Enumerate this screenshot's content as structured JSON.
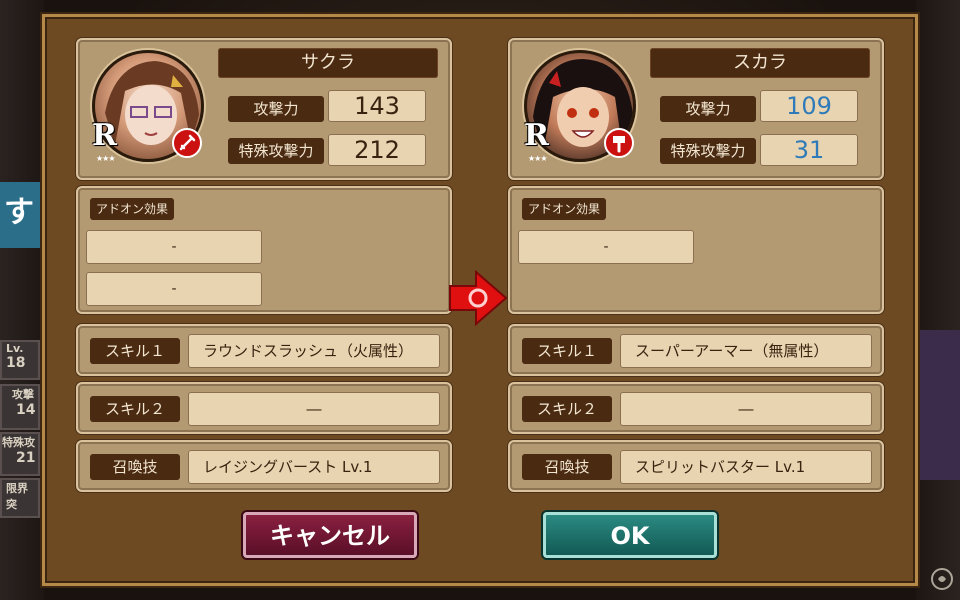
{
  "left": {
    "name": "サクラ",
    "rarity": "R",
    "stars": "★★★",
    "attack_label": "攻撃力",
    "attack_value": "143",
    "special_label": "特殊攻撃力",
    "special_value": "212",
    "addon_label": "アドオン効果",
    "addon_slots": [
      "-",
      "-"
    ],
    "skill1_label": "スキル１",
    "skill1_value": "ラウンドスラッシュ（火属性）",
    "skill2_label": "スキル２",
    "skill2_value": "―",
    "summon_label": "召喚技",
    "summon_value": "レイジングバースト Lv.1"
  },
  "right": {
    "name": "スカラ",
    "rarity": "R",
    "stars": "★★★",
    "attack_label": "攻撃力",
    "attack_value": "109",
    "special_label": "特殊攻撃力",
    "special_value": "31",
    "addon_label": "アドオン効果",
    "addon_slots": [
      "-"
    ],
    "skill1_label": "スキル１",
    "skill1_value": "スーパーアーマー（無属性）",
    "skill2_label": "スキル２",
    "skill2_value": "―",
    "summon_label": "召喚技",
    "summon_value": "スピリットバスター Lv.1"
  },
  "buttons": {
    "cancel": "キャンセル",
    "ok": "OK"
  },
  "background": {
    "blue_tab": "す",
    "lv_label": "Lv.",
    "lv_value": "18",
    "attack_short": "攻撃",
    "attack_value": "14",
    "special_short": "特殊攻",
    "special_value": "21",
    "limit_short": "限界突"
  },
  "colors": {
    "frame": "#6d4a22",
    "panel": "#b49a72",
    "label_bg": "#4a2a10",
    "value_bg": "#e8d4b0",
    "blue_value": "#2f7ab8",
    "cancel": "#8a2040",
    "ok": "#2a8a82",
    "arrow": "#e01010"
  },
  "icons": {
    "weapon_left": "sword-icon",
    "weapon_right": "hammer-icon",
    "arrow": "right-arrow-icon",
    "watermark": "gamer-logo-icon"
  }
}
